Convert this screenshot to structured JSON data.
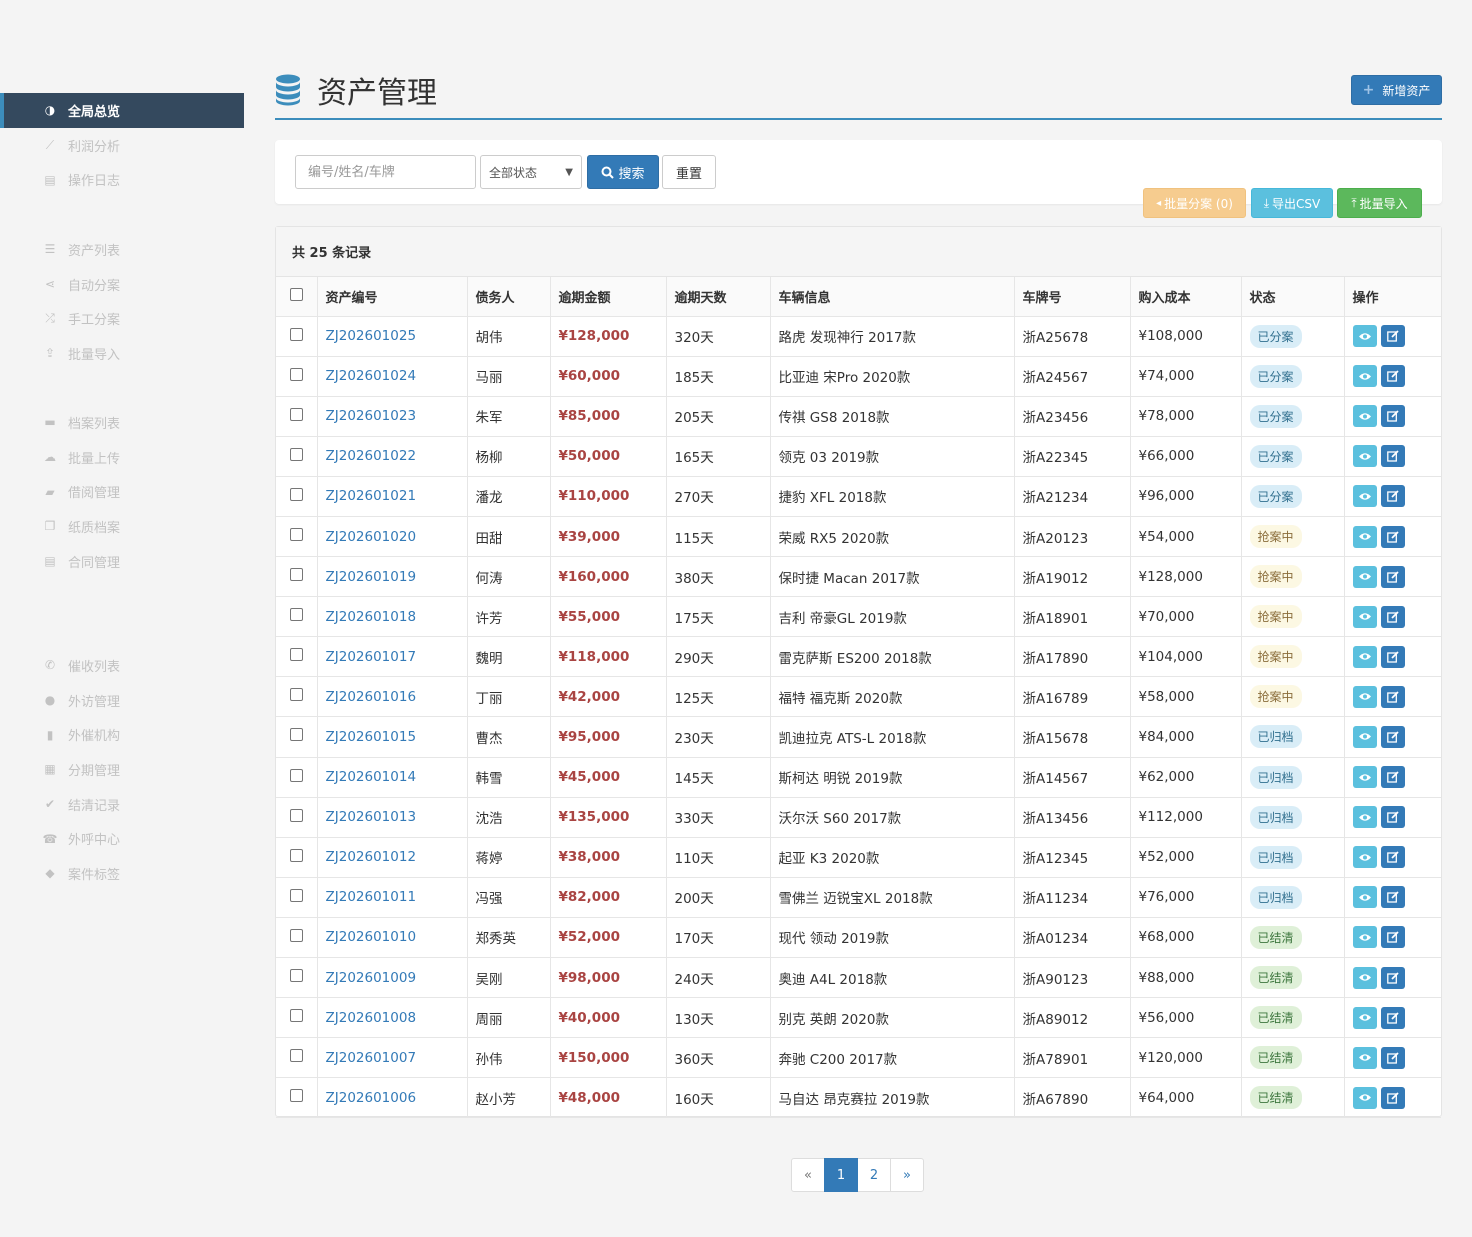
{
  "sidebar": {
    "group1": [
      {
        "label": "全局总览",
        "icon": "dashboard-icon",
        "glyph": "◑",
        "active": true
      },
      {
        "label": "利润分析",
        "icon": "line-chart-icon",
        "glyph": "⟋"
      },
      {
        "label": "操作日志",
        "icon": "file-icon",
        "glyph": "▤"
      }
    ],
    "group2": [
      {
        "label": "资产列表",
        "icon": "database-icon",
        "glyph": "☰"
      },
      {
        "label": "自动分案",
        "icon": "share-icon",
        "glyph": "⋖"
      },
      {
        "label": "手工分案",
        "icon": "random-icon",
        "glyph": "⤮"
      },
      {
        "label": "批量导入",
        "icon": "upload-icon",
        "glyph": "⇪"
      }
    ],
    "group3": [
      {
        "label": "档案列表",
        "icon": "folder-icon",
        "glyph": "▬"
      },
      {
        "label": "批量上传",
        "icon": "cloud-upload-icon",
        "glyph": "☁"
      },
      {
        "label": "借阅管理",
        "icon": "book-icon",
        "glyph": "▰"
      },
      {
        "label": "纸质档案",
        "icon": "copy-icon",
        "glyph": "❐"
      },
      {
        "label": "合同管理",
        "icon": "file-text-icon",
        "glyph": "▤"
      }
    ],
    "group4": [
      {
        "label": "催收列表",
        "icon": "phone-icon",
        "glyph": "✆"
      },
      {
        "label": "外访管理",
        "icon": "map-marker-icon",
        "glyph": "●"
      },
      {
        "label": "外催机构",
        "icon": "building-icon",
        "glyph": "▮"
      },
      {
        "label": "分期管理",
        "icon": "calendar-icon",
        "glyph": "▦"
      },
      {
        "label": "结清记录",
        "icon": "check-circle-icon",
        "glyph": "✔"
      },
      {
        "label": "外呼中心",
        "icon": "phone-square-icon",
        "glyph": "☎"
      },
      {
        "label": "案件标签",
        "icon": "tags-icon",
        "glyph": "◆"
      }
    ]
  },
  "header": {
    "title": "资产管理",
    "add_label": "新增资产"
  },
  "filter": {
    "search_placeholder": "编号/姓名/车牌",
    "status_selected": "全部状态",
    "search_label": "搜索",
    "reset_label": "重置"
  },
  "batch": {
    "assign_label": "批量分案 (0)",
    "export_label": "导出CSV",
    "import_label": "批量导入"
  },
  "table": {
    "summary": "共 25 条记录",
    "columns": [
      "资产编号",
      "债务人",
      "逾期金额",
      "逾期天数",
      "车辆信息",
      "车牌号",
      "购入成本",
      "状态",
      "操作"
    ],
    "rows": [
      {
        "no": "ZJ202601025",
        "name": "胡伟",
        "amount": "¥128,000",
        "days": "320天",
        "car": "路虎 发现神行 2017款",
        "plate": "浙A25678",
        "cost": "¥108,000",
        "status": "已分案",
        "type": "split"
      },
      {
        "no": "ZJ202601024",
        "name": "马丽",
        "amount": "¥60,000",
        "days": "185天",
        "car": "比亚迪 宋Pro 2020款",
        "plate": "浙A24567",
        "cost": "¥74,000",
        "status": "已分案",
        "type": "split"
      },
      {
        "no": "ZJ202601023",
        "name": "朱军",
        "amount": "¥85,000",
        "days": "205天",
        "car": "传祺 GS8 2018款",
        "plate": "浙A23456",
        "cost": "¥78,000",
        "status": "已分案",
        "type": "split"
      },
      {
        "no": "ZJ202601022",
        "name": "杨柳",
        "amount": "¥50,000",
        "days": "165天",
        "car": "领克 03 2019款",
        "plate": "浙A22345",
        "cost": "¥66,000",
        "status": "已分案",
        "type": "split"
      },
      {
        "no": "ZJ202601021",
        "name": "潘龙",
        "amount": "¥110,000",
        "days": "270天",
        "car": "捷豹 XFL 2018款",
        "plate": "浙A21234",
        "cost": "¥96,000",
        "status": "已分案",
        "type": "split"
      },
      {
        "no": "ZJ202601020",
        "name": "田甜",
        "amount": "¥39,000",
        "days": "115天",
        "car": "荣威 RX5 2020款",
        "plate": "浙A20123",
        "cost": "¥54,000",
        "status": "抢案中",
        "type": "grab"
      },
      {
        "no": "ZJ202601019",
        "name": "何涛",
        "amount": "¥160,000",
        "days": "380天",
        "car": "保时捷 Macan 2017款",
        "plate": "浙A19012",
        "cost": "¥128,000",
        "status": "抢案中",
        "type": "grab"
      },
      {
        "no": "ZJ202601018",
        "name": "许芳",
        "amount": "¥55,000",
        "days": "175天",
        "car": "吉利 帝豪GL 2019款",
        "plate": "浙A18901",
        "cost": "¥70,000",
        "status": "抢案中",
        "type": "grab"
      },
      {
        "no": "ZJ202601017",
        "name": "魏明",
        "amount": "¥118,000",
        "days": "290天",
        "car": "雷克萨斯 ES200 2018款",
        "plate": "浙A17890",
        "cost": "¥104,000",
        "status": "抢案中",
        "type": "grab"
      },
      {
        "no": "ZJ202601016",
        "name": "丁丽",
        "amount": "¥42,000",
        "days": "125天",
        "car": "福特 福克斯 2020款",
        "plate": "浙A16789",
        "cost": "¥58,000",
        "status": "抢案中",
        "type": "grab"
      },
      {
        "no": "ZJ202601015",
        "name": "曹杰",
        "amount": "¥95,000",
        "days": "230天",
        "car": "凯迪拉克 ATS-L 2018款",
        "plate": "浙A15678",
        "cost": "¥84,000",
        "status": "已归档",
        "type": "arch"
      },
      {
        "no": "ZJ202601014",
        "name": "韩雪",
        "amount": "¥45,000",
        "days": "145天",
        "car": "斯柯达 明锐 2019款",
        "plate": "浙A14567",
        "cost": "¥62,000",
        "status": "已归档",
        "type": "arch"
      },
      {
        "no": "ZJ202601013",
        "name": "沈浩",
        "amount": "¥135,000",
        "days": "330天",
        "car": "沃尔沃 S60 2017款",
        "plate": "浙A13456",
        "cost": "¥112,000",
        "status": "已归档",
        "type": "arch"
      },
      {
        "no": "ZJ202601012",
        "name": "蒋婷",
        "amount": "¥38,000",
        "days": "110天",
        "car": "起亚 K3 2020款",
        "plate": "浙A12345",
        "cost": "¥52,000",
        "status": "已归档",
        "type": "arch"
      },
      {
        "no": "ZJ202601011",
        "name": "冯强",
        "amount": "¥82,000",
        "days": "200天",
        "car": "雪佛兰 迈锐宝XL 2018款",
        "plate": "浙A11234",
        "cost": "¥76,000",
        "status": "已归档",
        "type": "arch"
      },
      {
        "no": "ZJ202601010",
        "name": "郑秀英",
        "amount": "¥52,000",
        "days": "170天",
        "car": "现代 领动 2019款",
        "plate": "浙A01234",
        "cost": "¥68,000",
        "status": "已结清",
        "type": "done"
      },
      {
        "no": "ZJ202601009",
        "name": "吴刚",
        "amount": "¥98,000",
        "days": "240天",
        "car": "奥迪 A4L 2018款",
        "plate": "浙A90123",
        "cost": "¥88,000",
        "status": "已结清",
        "type": "done"
      },
      {
        "no": "ZJ202601008",
        "name": "周丽",
        "amount": "¥40,000",
        "days": "130天",
        "car": "别克 英朗 2020款",
        "plate": "浙A89012",
        "cost": "¥56,000",
        "status": "已结清",
        "type": "done"
      },
      {
        "no": "ZJ202601007",
        "name": "孙伟",
        "amount": "¥150,000",
        "days": "360天",
        "car": "奔驰 C200 2017款",
        "plate": "浙A78901",
        "cost": "¥120,000",
        "status": "已结清",
        "type": "done"
      },
      {
        "no": "ZJ202601006",
        "name": "赵小芳",
        "amount": "¥48,000",
        "days": "160天",
        "car": "马自达 昂克赛拉 2019款",
        "plate": "浙A67890",
        "cost": "¥64,000",
        "status": "已结清",
        "type": "done"
      }
    ]
  },
  "pagination": {
    "prev": "«",
    "pages": [
      "1",
      "2"
    ],
    "current": "1",
    "next": "»"
  },
  "colors": {
    "primary": "#337ab7",
    "sidebar_active": "#34495e",
    "danger_text": "#a94442",
    "info": "#5bc0de",
    "success": "#5cb85c",
    "warning_light": "#f6cc8f"
  }
}
